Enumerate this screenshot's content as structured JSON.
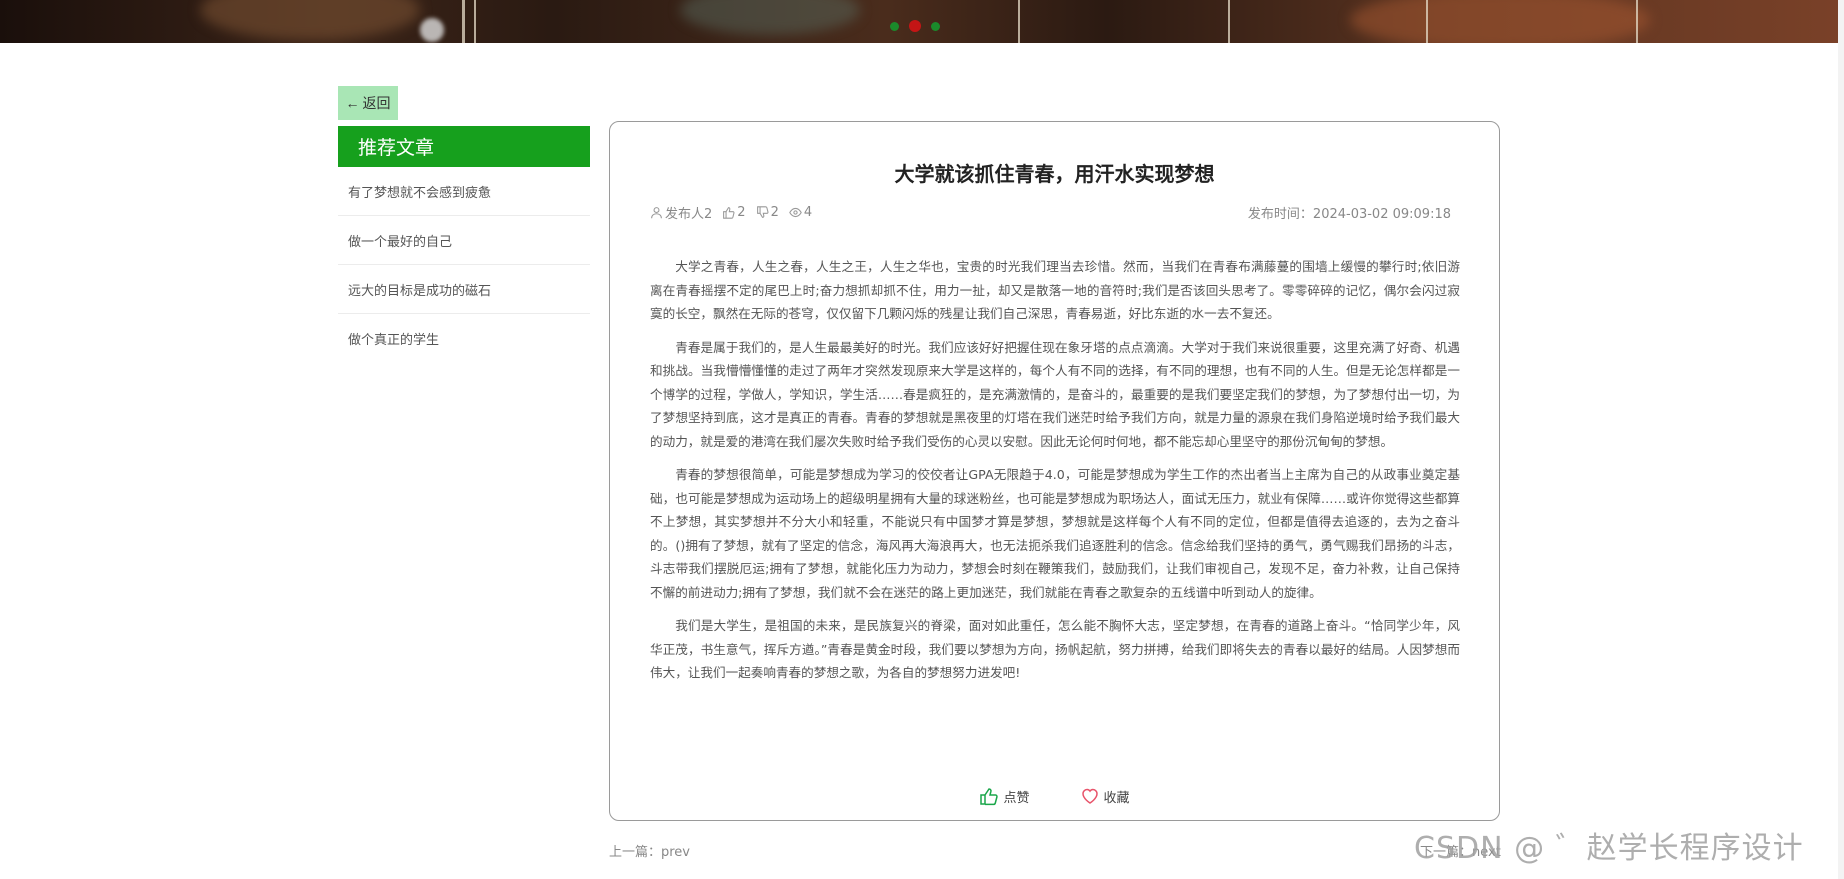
{
  "banner": {
    "carousel_dots": 3,
    "active_dot": 1
  },
  "back_button": {
    "label": "返回"
  },
  "sidebar": {
    "title": "推荐文章",
    "items": [
      {
        "label": "有了梦想就不会感到疲惫"
      },
      {
        "label": "做一个最好的自己"
      },
      {
        "label": "远大的目标是成功的磁石"
      },
      {
        "label": "做个真正的学生"
      }
    ]
  },
  "article": {
    "title": "大学就该抓住青春，用汗水实现梦想",
    "author": "发布人2",
    "likes": "2",
    "dislikes": "2",
    "views": "4",
    "publish_label": "发布时间：",
    "publish_time": "2024-03-02 09:09:18",
    "paragraphs": [
      "大学之青春，人生之春，人生之王，人生之华也，宝贵的时光我们理当去珍惜。然而，当我们在青春布满藤蔓的围墙上缓慢的攀行时;依旧游离在青春摇摆不定的尾巴上时;奋力想抓却抓不住，用力一扯，却又是散落一地的音符时;我们是否该回头思考了。零零碎碎的记忆，偶尔会闪过寂寞的长空，飘然在无际的苍穹，仅仅留下几颗闪烁的残星让我们自己深思，青春易逝，好比东逝的水一去不复还。",
      "青春是属于我们的，是人生最最美好的时光。我们应该好好把握住现在象牙塔的点点滴滴。大学对于我们来说很重要，这里充满了好奇、机遇和挑战。当我懵懵懂懂的走过了两年才突然发现原来大学是这样的，每个人有不同的选择，有不同的理想，也有不同的人生。但是无论怎样都是一个博学的过程，学做人，学知识，学生活……春是疯狂的，是充满激情的，是奋斗的，最重要的是我们要坚定我们的梦想，为了梦想付出一切，为了梦想坚持到底，这才是真正的青春。青春的梦想就是黑夜里的灯塔在我们迷茫时给予我们方向，就是力量的源泉在我们身陷逆境时给予我们最大的动力，就是爱的港湾在我们屡次失败时给予我们受伤的心灵以安慰。因此无论何时何地，都不能忘却心里坚守的那份沉甸甸的梦想。",
      "青春的梦想很简单，可能是梦想成为学习的佼佼者让GPA无限趋于4.0，可能是梦想成为学生工作的杰出者当上主席为自己的从政事业奠定基础，也可能是梦想成为运动场上的超级明星拥有大量的球迷粉丝，也可能是梦想成为职场达人，面试无压力，就业有保障……或许你觉得这些都算不上梦想，其实梦想并不分大小和轻重，不能说只有中国梦才算是梦想，梦想就是这样每个人有不同的定位，但都是值得去追逐的，去为之奋斗的。()拥有了梦想，就有了坚定的信念，海风再大海浪再大，也无法扼杀我们追逐胜利的信念。信念给我们坚持的勇气，勇气赐我们昂扬的斗志，斗志带我们摆脱厄运;拥有了梦想，就能化压力为动力，梦想会时刻在鞭策我们，鼓励我们，让我们审视自己，发现不足，奋力补救，让自己保持不懈的前进动力;拥有了梦想，我们就不会在迷茫的路上更加迷茫，我们就能在青春之歌复杂的五线谱中听到动人的旋律。",
      "我们是大学生，是祖国的未来，是民族复兴的脊梁，面对如此重任，怎么能不胸怀大志，坚定梦想，在青春的道路上奋斗。“恰同学少年，风华正茂，书生意气，挥斥方遒。”青春是黄金时段，我们要以梦想为方向，扬帆起航，努力拼搏，给我们即将失去的青春以最好的结局。人因梦想而伟大，让我们一起奏响青春的梦想之歌，为各自的梦想努力进发吧!"
    ],
    "like_label": "点赞",
    "collect_label": "收藏"
  },
  "nav": {
    "prev": "上一篇：prev",
    "next": "下一篇：next"
  },
  "watermark": "CSDN @ ゛赵学长程序设计",
  "colors": {
    "sidebar_header": "#16a01d",
    "back_button": "#a9e6b5",
    "like_icon": "#1aa64a",
    "collect_icon": "#e8536a",
    "active_dot": "#c41515",
    "dot": "#1b8a2b"
  }
}
